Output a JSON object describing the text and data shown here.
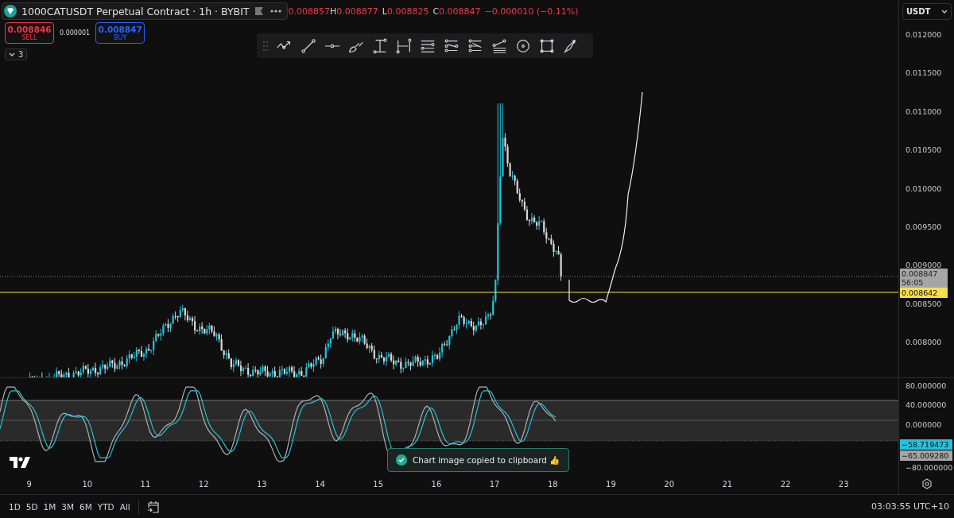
{
  "header": {
    "title": "1000CATUSDT Perpetual Contract · 1h · BYBIT",
    "open_value": "0.008857",
    "ohlc": [
      {
        "label": "H",
        "value": "0.008877"
      },
      {
        "label": "L",
        "value": "0.008825"
      },
      {
        "label": "C",
        "value": "0.008847"
      }
    ],
    "change": "−0.000010 (−0.11%)"
  },
  "trade": {
    "sell": {
      "price": "0.008846",
      "label": "SELL"
    },
    "spread": "0.000001",
    "buy": {
      "price": "0.008847",
      "label": "BUY"
    }
  },
  "indicators_toggle": {
    "count": "3"
  },
  "currency": {
    "value": "USDT"
  },
  "price_axis": [
    "0.012000",
    "0.011500",
    "0.011000",
    "0.010500",
    "0.010000",
    "0.009500",
    "0.009000",
    "0.008500",
    "0.008000"
  ],
  "last_price": {
    "value": "0.008847",
    "countdown": "56:05"
  },
  "alert_price": {
    "value": "0.008642"
  },
  "oscillator_axis": [
    "80.000000",
    "40.000000",
    "0.000000",
    "−80.000000"
  ],
  "oscillator_values": [
    {
      "value": "−58.719473",
      "color": "#22c3dc"
    },
    {
      "value": "−65.009280",
      "color": "#a5a5a5"
    }
  ],
  "time_axis": [
    "9",
    "10",
    "11",
    "12",
    "13",
    "14",
    "15",
    "16",
    "17",
    "18",
    "19",
    "20",
    "21",
    "22",
    "23"
  ],
  "toast": {
    "message": "Chart image copied to clipboard 👍"
  },
  "ranges": [
    "1D",
    "5D",
    "1M",
    "3M",
    "6M",
    "YTD",
    "All"
  ],
  "clock": "03:03:55 UTC+10"
}
